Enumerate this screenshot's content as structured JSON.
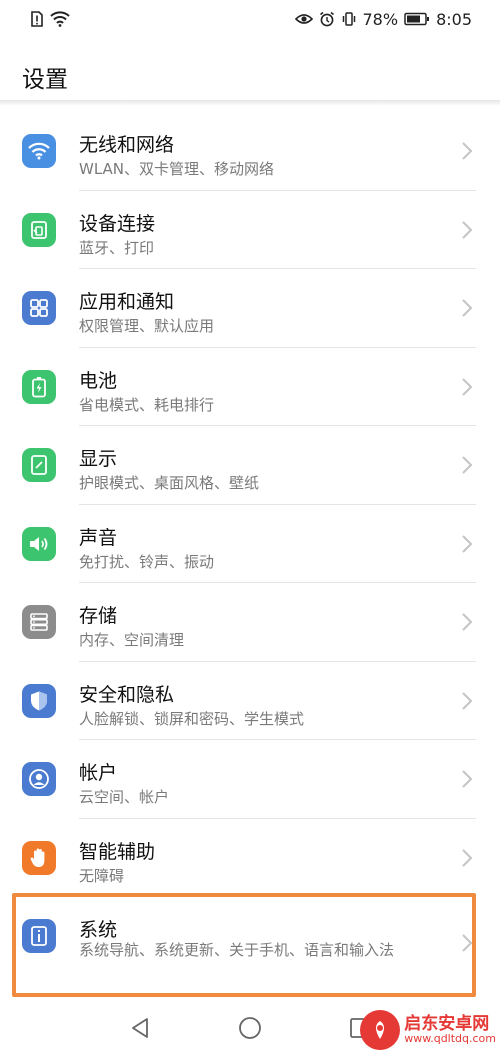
{
  "status_bar": {
    "battery_percent": "78%",
    "time": "8:05"
  },
  "header": {
    "title": "设置"
  },
  "items": [
    {
      "title": "无线和网络",
      "sub": "WLAN、双卡管理、移动网络",
      "icon": "wifi-icon",
      "color": "#4a90e2"
    },
    {
      "title": "设备连接",
      "sub": "蓝牙、打印",
      "icon": "device-connection-icon",
      "color": "#3cc46e"
    },
    {
      "title": "应用和通知",
      "sub": "权限管理、默认应用",
      "icon": "apps-grid-icon",
      "color": "#4a7bd0"
    },
    {
      "title": "电池",
      "sub": "省电模式、耗电排行",
      "icon": "battery-icon",
      "color": "#3cc46e"
    },
    {
      "title": "显示",
      "sub": "护眼模式、桌面风格、壁纸",
      "icon": "display-icon",
      "color": "#3cc46e"
    },
    {
      "title": "声音",
      "sub": "免打扰、铃声、振动",
      "icon": "speaker-icon",
      "color": "#3cc46e"
    },
    {
      "title": "存储",
      "sub": "内存、空间清理",
      "icon": "storage-icon",
      "color": "#8c8c8c"
    },
    {
      "title": "安全和隐私",
      "sub": "人脸解锁、锁屏和密码、学生模式",
      "icon": "shield-icon",
      "color": "#4a7bd0"
    },
    {
      "title": "帐户",
      "sub": "云空间、帐户",
      "icon": "account-icon",
      "color": "#4a7bd0"
    },
    {
      "title": "智能辅助",
      "sub": "无障碍",
      "icon": "hand-icon",
      "color": "#f07a2a"
    },
    {
      "title": "系统",
      "sub": "系统导航、系统更新、关于手机、语言和输入法",
      "icon": "info-icon",
      "color": "#4a7bd0"
    }
  ],
  "highlight_color": "#f08a3c",
  "watermark": {
    "cn": "启东安卓网",
    "url": "www.qdltdq.com"
  }
}
